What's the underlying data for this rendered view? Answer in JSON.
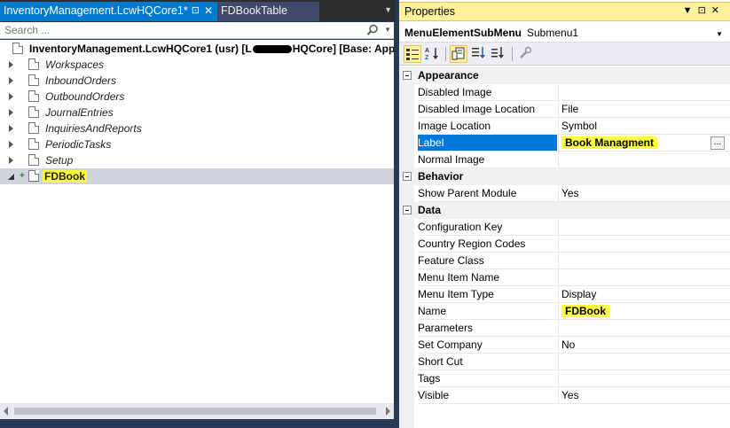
{
  "left": {
    "tabs": {
      "active": "InventoryManagement.LcwHQCore1*",
      "inactive": "FDBookTable"
    },
    "search": {
      "placeholder": "Search ..."
    },
    "tree": {
      "root": {
        "text_start": "InventoryManagement.LcwHQCore1 (usr) [L",
        "text_end": "HQCore] [Base: Application"
      },
      "children": [
        "Workspaces",
        "InboundOrders",
        "OutboundOrders",
        "JournalEntries",
        "InquiriesAndReports",
        "PeriodicTasks",
        "Setup"
      ],
      "selected": "FDBook"
    }
  },
  "properties": {
    "title": "Properties",
    "object_type": "MenuElementSubMenu",
    "object_name": "Submenu1",
    "categories": [
      {
        "name": "Appearance",
        "rows": [
          {
            "name": "Disabled Image",
            "value": ""
          },
          {
            "name": "Disabled Image Location",
            "value": "File"
          },
          {
            "name": "Image Location",
            "value": "Symbol"
          },
          {
            "name": "Label",
            "value": "Book Managment"
          },
          {
            "name": "Normal Image",
            "value": ""
          }
        ]
      },
      {
        "name": "Behavior",
        "rows": [
          {
            "name": "Show Parent Module",
            "value": "Yes"
          }
        ]
      },
      {
        "name": "Data",
        "rows": [
          {
            "name": "Configuration Key",
            "value": ""
          },
          {
            "name": "Country Region Codes",
            "value": ""
          },
          {
            "name": "Feature Class",
            "value": ""
          },
          {
            "name": "Menu Item Name",
            "value": ""
          },
          {
            "name": "Menu Item Type",
            "value": "Display"
          },
          {
            "name": "Name",
            "value": "FDBook"
          },
          {
            "name": "Parameters",
            "value": ""
          },
          {
            "name": "Set Company",
            "value": "No"
          },
          {
            "name": "Short Cut",
            "value": ""
          },
          {
            "name": "Tags",
            "value": ""
          },
          {
            "name": "Visible",
            "value": "Yes"
          }
        ]
      }
    ],
    "ellipsis": "...",
    "highlight_color": "#ffff3a",
    "selection_color": "#0078d7"
  }
}
